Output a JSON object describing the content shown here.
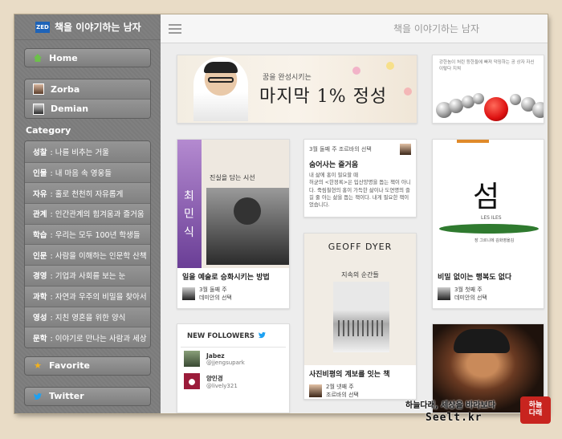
{
  "brand": {
    "logo": "ZED",
    "title": "책을 이야기하는 남자"
  },
  "sidebar": {
    "home": {
      "label": "Home",
      "icon": "home-icon"
    },
    "authors": [
      {
        "label": "Zorba"
      },
      {
        "label": "Demian"
      }
    ],
    "category_title": "Category",
    "categories": [
      {
        "name": "성찰",
        "desc": ": 나를 비추는 거울"
      },
      {
        "name": "인물",
        "desc": ": 내 마음 속 영웅들"
      },
      {
        "name": "자유",
        "desc": ": 홀로 천천히 자유롭게"
      },
      {
        "name": "관계",
        "desc": ": 인간관계의 힘겨움과 즐거움"
      },
      {
        "name": "학습",
        "desc": ": 우리는 모두 100년 학생들"
      },
      {
        "name": "인문",
        "desc": ": 사람을 이해하는 인문학 산책"
      },
      {
        "name": "경영",
        "desc": ": 기업과 사회를 보는 눈"
      },
      {
        "name": "과학",
        "desc": ": 자연과 우주의 비밀을 찾아서"
      },
      {
        "name": "영성",
        "desc": ": 지친 영혼을 위한 양식"
      },
      {
        "name": "문학",
        "desc": ": 이야기로 만나는 사람과 세상"
      }
    ],
    "favorite": {
      "label": "Favorite"
    },
    "twitter": {
      "label": "Twitter"
    }
  },
  "topbar": {
    "title": "책을 이야기하는 남자"
  },
  "banner": {
    "subtitle": "꿈을 완성시키는",
    "title": "마지막 1% 정성"
  },
  "sphere_card": {
    "text": "강한놈이 처린 등한들에 빠져 덕밍하는 공 상자 자신 이렇다 지쳐"
  },
  "cards": {
    "art": {
      "cover_caption": "진실을 담는 시선",
      "cover_side": "최민식",
      "title": "일을 예술로 승화시키는 방법",
      "meta1": "3월 둘째 주",
      "meta2": "데미안의 선택"
    },
    "quote": {
      "meta": "3월 둘째 주 조르바의 선택",
      "title": "숨어사는 즐거움",
      "body": "내 삶에 홍이 필요할 때\n허균의 <한정록>은 입산양명을 돕는 책이 아니다. 죽림칠현의 홍이 가득한 삶이나 도연명의 즐길 줄 아는 삶을 돕는 책이다. 내게 필요한 책이었습니다."
    },
    "seom": {
      "cover_title": "섬",
      "cover_sub": "LES ILES",
      "cover_author": "장 그르니에 김화영옮김",
      "title": "비밀 없이는 행복도 없다",
      "meta1": "3월 첫째 주",
      "meta2": "데미안의 선택"
    },
    "geoff": {
      "author": "GEOFF DYER",
      "kor_title": "지속의 순간들",
      "title": "사진비평의 계보를 잇는 책",
      "meta1": "2월 넷째 주",
      "meta2": "조르바의 선택"
    },
    "followers": {
      "title": "NEW FOLLOWERS",
      "items": [
        {
          "name": "Jabez",
          "handle": "@jjengsupark"
        },
        {
          "name": "양인경",
          "handle": "@lively321"
        }
      ]
    }
  },
  "watermark": {
    "line1": "하늘다래, 세상을 바라보다",
    "line2": "Seelt.kr",
    "logo_top": "하늘",
    "logo_bottom": "다래"
  }
}
